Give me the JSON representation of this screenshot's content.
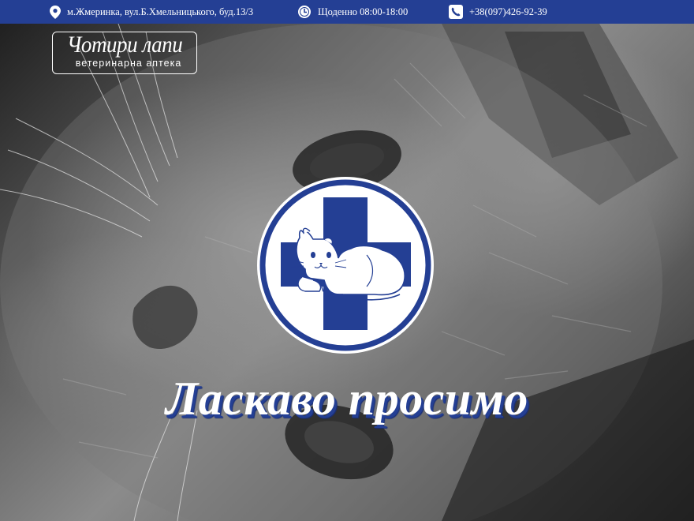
{
  "topbar": {
    "address": "м.Жмеринка, вул.Б.Хмельницького, буд.13/3",
    "address_icon": "map-pin-icon",
    "hours": "Щоденно 08:00-18:00",
    "hours_icon": "clock-icon",
    "phone": "+38(097)426-92-39",
    "phone_icon": "phone-icon",
    "background_color": "#243f94"
  },
  "logo": {
    "title": "Чотири лапи",
    "subtitle": "ветеринарна аптека"
  },
  "emblem": {
    "icon": "vet-cross-cat-icon",
    "cross_color": "#243f94"
  },
  "hero": {
    "welcome": "Ласкаво просимо",
    "background_image": "grayscale-cat-photo"
  }
}
